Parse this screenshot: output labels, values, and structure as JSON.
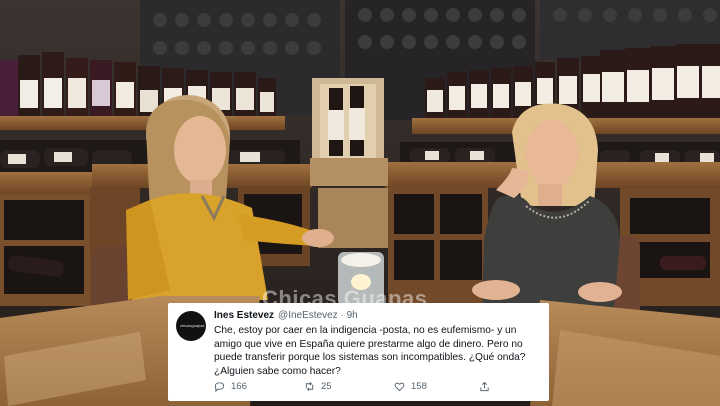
{
  "tweet": {
    "avatar_text": "chicasguapas",
    "name": "Ines Estevez",
    "handle": "@IneEstevez",
    "separator": "·",
    "time": "9h",
    "text": "Che, estoy por caer en la indigencia -posta, no es eufemismo- y un amigo que vive en España quiere prestarme algo de dinero. Pero no puede transferir porque los sistemas son incompatibles. ¿Qué onda? ¿Alguien sabe como hacer?",
    "replies": "166",
    "retweets": "25",
    "likes": "158"
  },
  "watermark": "Chicas Guapas",
  "colors": {
    "wood": "#8a5a32",
    "yellow_dress": "#d9a22a",
    "tweet_bg": "#ffffff"
  }
}
